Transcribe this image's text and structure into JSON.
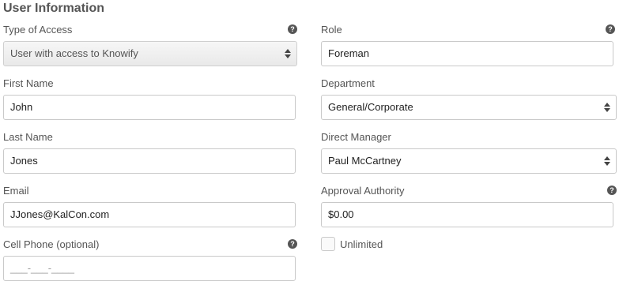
{
  "section_title": "User Information",
  "left": {
    "type_of_access": {
      "label": "Type of Access",
      "value": "User with access to Knowify"
    },
    "first_name": {
      "label": "First Name",
      "value": "John"
    },
    "last_name": {
      "label": "Last Name",
      "value": "Jones"
    },
    "email": {
      "label": "Email",
      "value": "JJones@KalCon.com"
    },
    "cell_phone": {
      "label": "Cell Phone (optional)",
      "placeholder": "___-___-____"
    }
  },
  "right": {
    "role": {
      "label": "Role",
      "value": "Foreman"
    },
    "department": {
      "label": "Department",
      "value": "General/Corporate"
    },
    "direct_manager": {
      "label": "Direct Manager",
      "value": "Paul McCartney"
    },
    "approval_authority": {
      "label": "Approval Authority",
      "value": "$0.00"
    },
    "unlimited": {
      "label": "Unlimited",
      "checked": false
    }
  },
  "help_icon_glyph": "?"
}
